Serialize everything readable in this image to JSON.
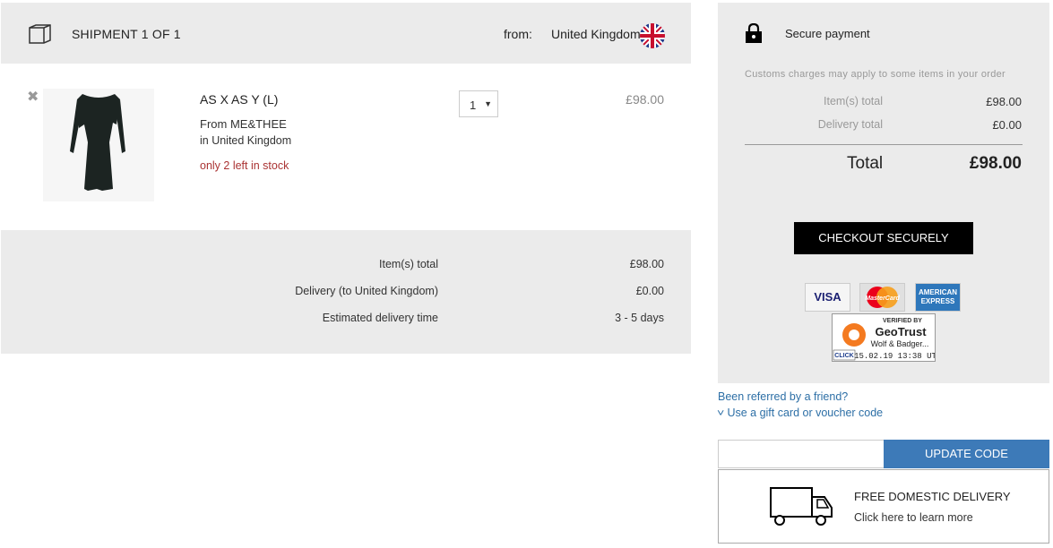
{
  "shipment": {
    "title": "SHIPMENT 1 OF 1",
    "from_label": "from:",
    "from_country": "United Kingdom"
  },
  "item": {
    "remove_glyph": "✖",
    "name": "AS X AS Y (L)",
    "brand": "From ME&THEE",
    "location": "in United Kingdom",
    "stock": "only 2 left in stock",
    "quantity": "1",
    "price": "£98.00"
  },
  "shipment_summary": {
    "rows": [
      {
        "label": "Item(s) total",
        "value": "£98.00"
      },
      {
        "label": "Delivery (to United Kingdom)",
        "value": "£0.00"
      },
      {
        "label": "Estimated delivery time",
        "value": "3 - 5 days"
      }
    ]
  },
  "payment": {
    "title": "Secure payment",
    "customs_note": "Customs charges may apply to some items in your order",
    "items_label": "Item(s) total",
    "items_value": "£98.00",
    "delivery_label": "Delivery total",
    "delivery_value": "£0.00",
    "total_label": "Total",
    "total_value": "£98.00",
    "checkout_label": "CHECKOUT SECURELY",
    "cards": {
      "visa": "VISA",
      "mastercard": "MasterCard",
      "amex": "AMERICAN EXPRESS"
    },
    "geotrust": {
      "verified": "VERIFIED BY",
      "brand": "GeoTrust",
      "site": "Wolf & Badger...",
      "click": "CLICK",
      "date": "15.02.19 13:38 UT"
    }
  },
  "voucher": {
    "referred": "Been referred by a friend?",
    "gift": "Use a gift card or voucher code",
    "input_value": "",
    "update_label": "UPDATE CODE"
  },
  "delivery_promo": {
    "title": "FREE DOMESTIC DELIVERY",
    "subtitle": "Click here to learn more"
  },
  "colors": {
    "panel_bg": "#ebebeb",
    "link": "#2d6fa6",
    "stock_warning": "#a33333",
    "update_button": "#3d7ab8",
    "checkout_button": "#000000"
  }
}
